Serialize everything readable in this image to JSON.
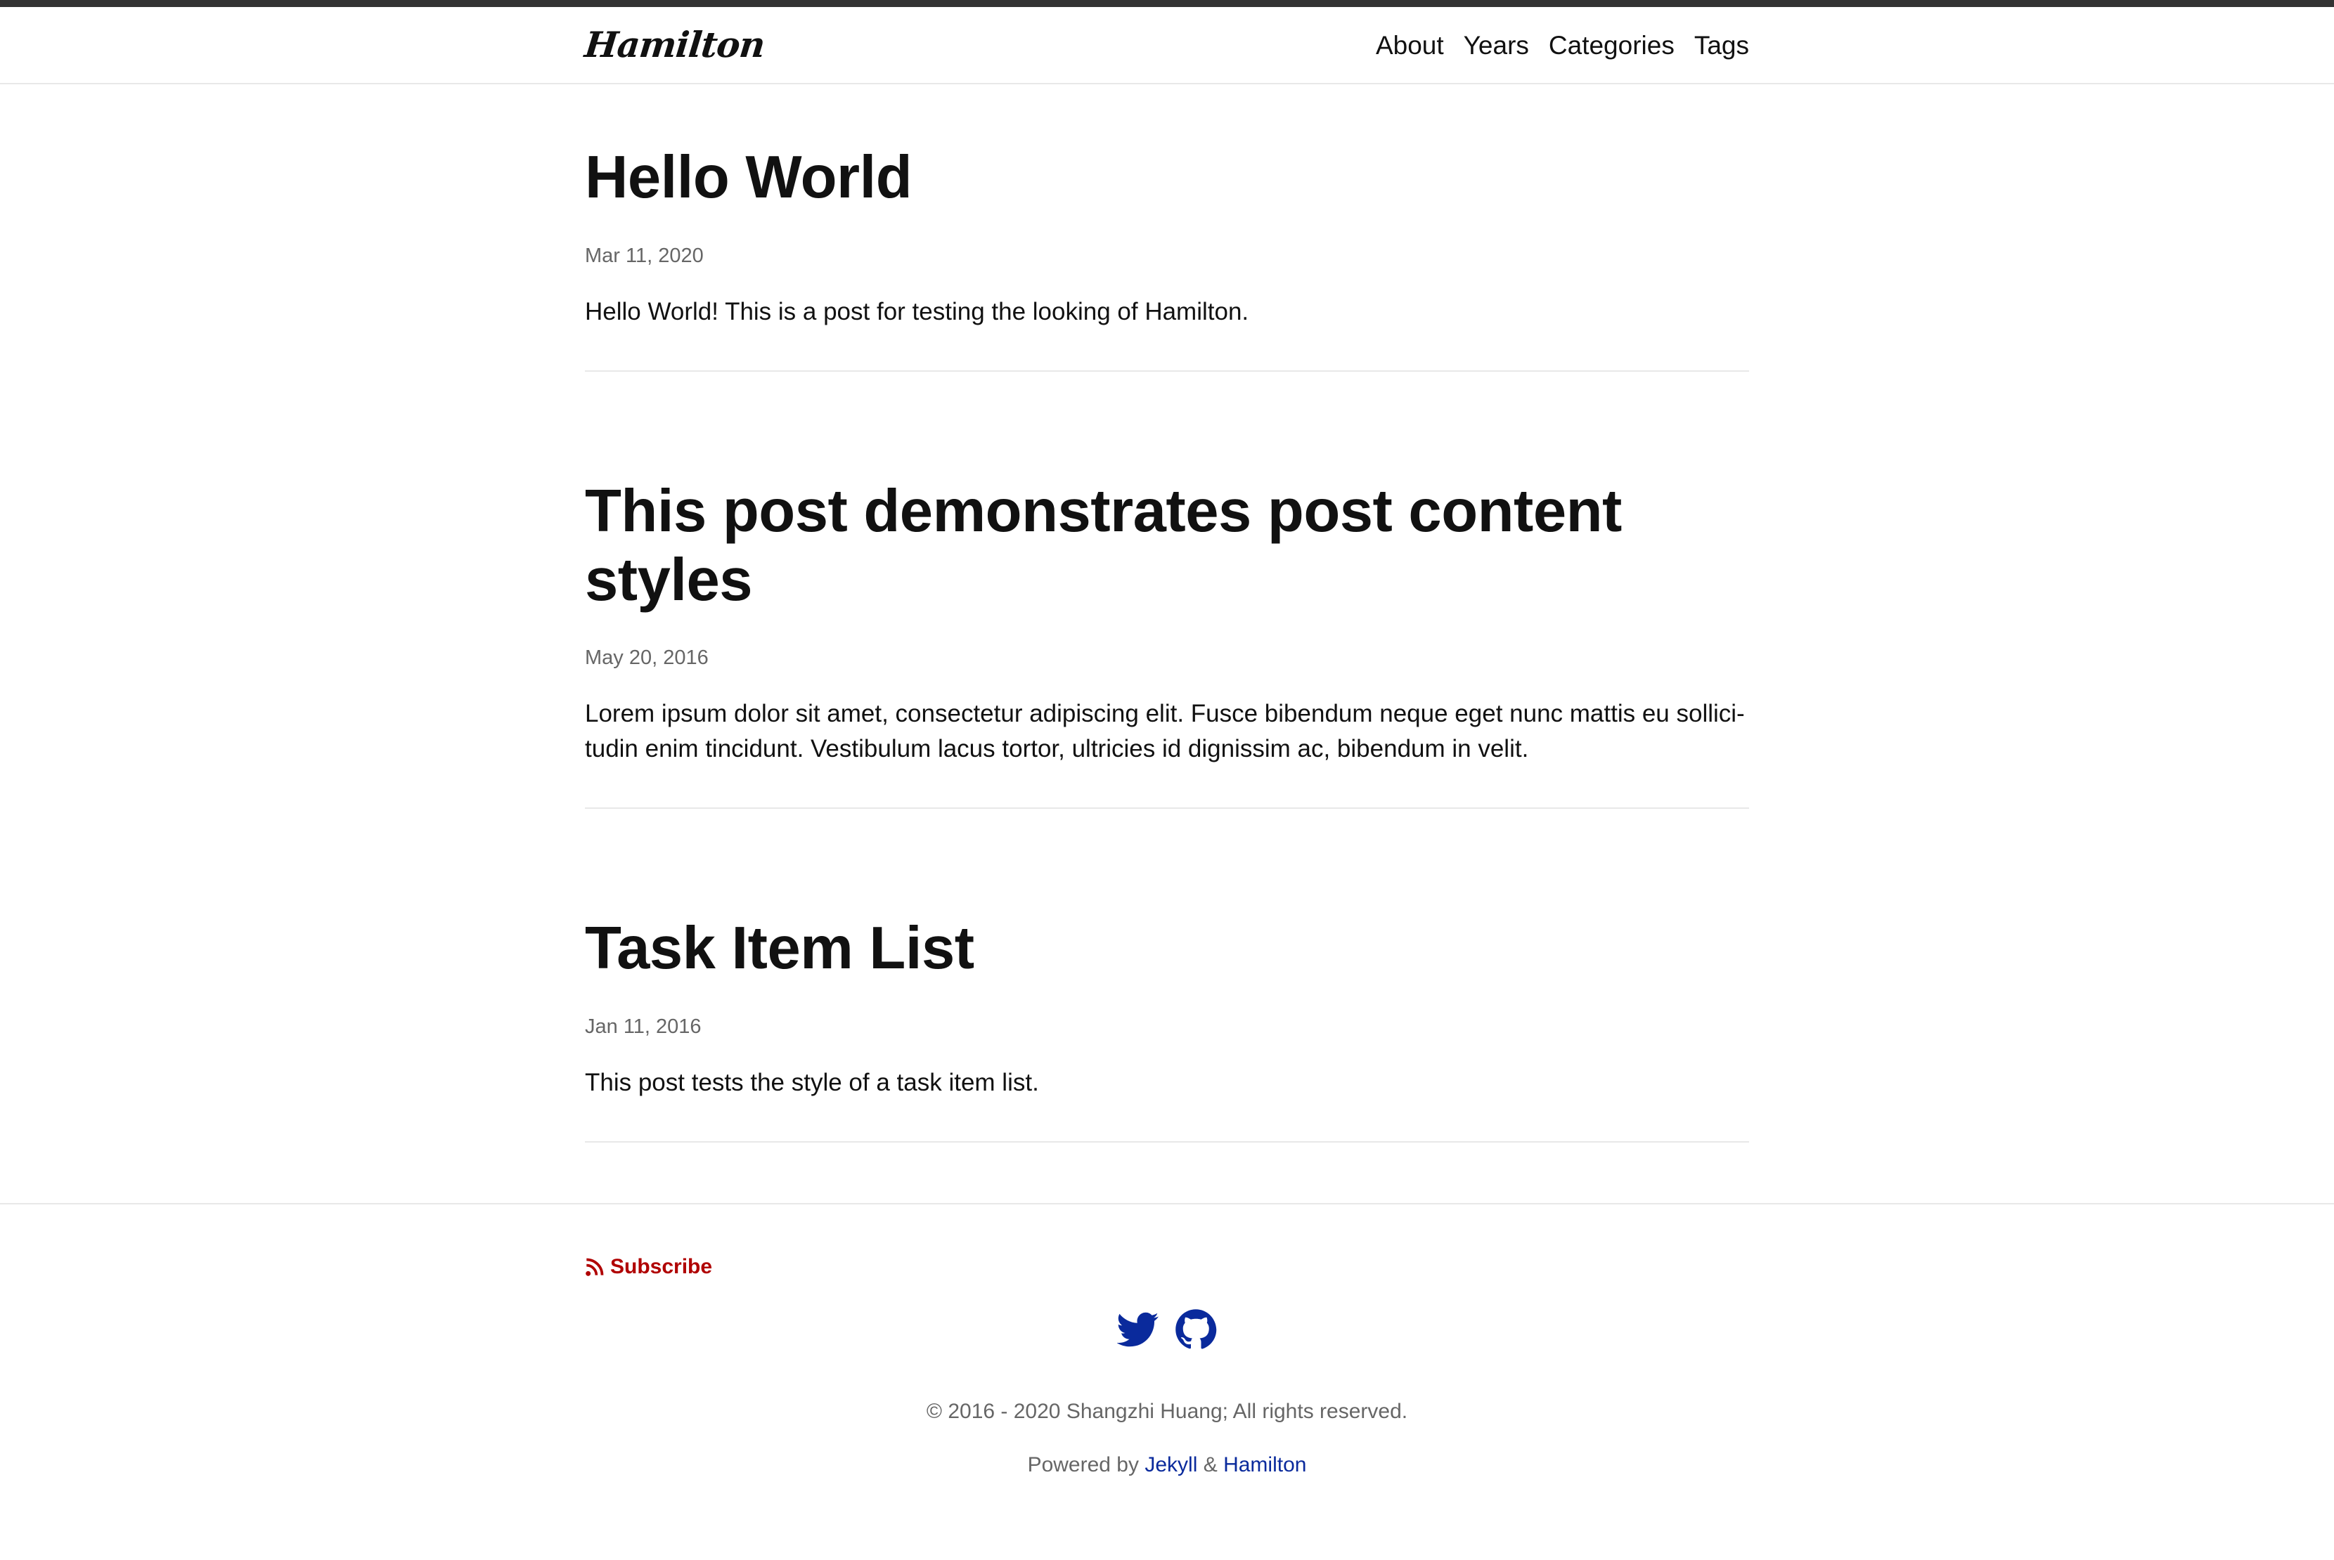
{
  "header": {
    "site_title": "Hamilton",
    "nav": [
      {
        "label": "About"
      },
      {
        "label": "Years"
      },
      {
        "label": "Categories"
      },
      {
        "label": "Tags"
      }
    ]
  },
  "posts": [
    {
      "title": "Hello World",
      "date": "Mar 11, 2020",
      "excerpt": "Hello World! This is a post for testing the looking of Hamilton."
    },
    {
      "title": "This post demonstrates post content styles",
      "date": "May 20, 2016",
      "excerpt": "Lorem ipsum dolor sit amet, consectetur adipiscing elit. Fusce bibendum neque eget nunc mattis eu sollici-tudin enim tincidunt. Vestibulum lacus tortor, ultricies id dignissim ac, bibendum in velit."
    },
    {
      "title": "Task Item List",
      "date": "Jan 11, 2016",
      "excerpt": "This post tests the style of a task item list."
    }
  ],
  "footer": {
    "subscribe_label": "Subscribe",
    "social_icons": [
      "twitter-icon",
      "github-icon"
    ],
    "copyright": "© 2016 - 2020 Shangzhi Huang; All rights reserved.",
    "powered_by": "Powered by",
    "jekyll_label": "Jekyll",
    "ampersand": "&",
    "hamilton_label": "Hamilton"
  },
  "colors": {
    "top_bar": "#333333",
    "subscribe": "#b00000",
    "link": "#0a2a9c",
    "meta_text": "#666666",
    "divider": "#e8e8e8"
  }
}
